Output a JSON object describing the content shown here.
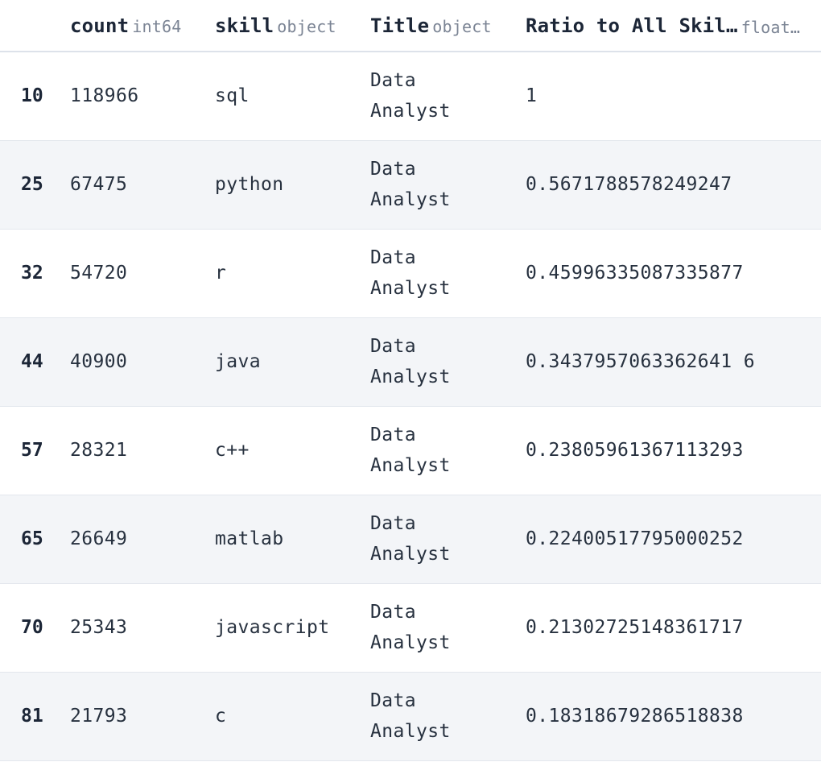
{
  "table": {
    "columns": [
      {
        "name": "count",
        "dtype": "int64"
      },
      {
        "name": "skill",
        "dtype": "object"
      },
      {
        "name": "Title",
        "dtype": "object"
      },
      {
        "name": "Ratio to All Skil…",
        "dtype": "float…"
      }
    ],
    "rows": [
      {
        "index": "10",
        "count": "118966",
        "skill": "sql",
        "title_line1": "Data",
        "title_line2": "Analyst",
        "ratio": "1"
      },
      {
        "index": "25",
        "count": "67475",
        "skill": "python",
        "title_line1": "Data",
        "title_line2": "Analyst",
        "ratio": "0.5671788578249247"
      },
      {
        "index": "32",
        "count": "54720",
        "skill": "r",
        "title_line1": "Data",
        "title_line2": "Analyst",
        "ratio": "0.45996335087335877"
      },
      {
        "index": "44",
        "count": "40900",
        "skill": "java",
        "title_line1": "Data",
        "title_line2": "Analyst",
        "ratio": "0.3437957063362641 6"
      },
      {
        "index": "57",
        "count": "28321",
        "skill": "c++",
        "title_line1": "Data",
        "title_line2": "Analyst",
        "ratio": "0.23805961367113293"
      },
      {
        "index": "65",
        "count": "26649",
        "skill": "matlab",
        "title_line1": "Data",
        "title_line2": "Analyst",
        "ratio": "0.22400517795000252"
      },
      {
        "index": "70",
        "count": "25343",
        "skill": "javascript",
        "title_line1": "Data",
        "title_line2": "Analyst",
        "ratio": "0.21302725148361717"
      },
      {
        "index": "81",
        "count": "21793",
        "skill": "c",
        "title_line1": "Data",
        "title_line2": "Analyst",
        "ratio": "0.18318679286518838"
      }
    ]
  }
}
